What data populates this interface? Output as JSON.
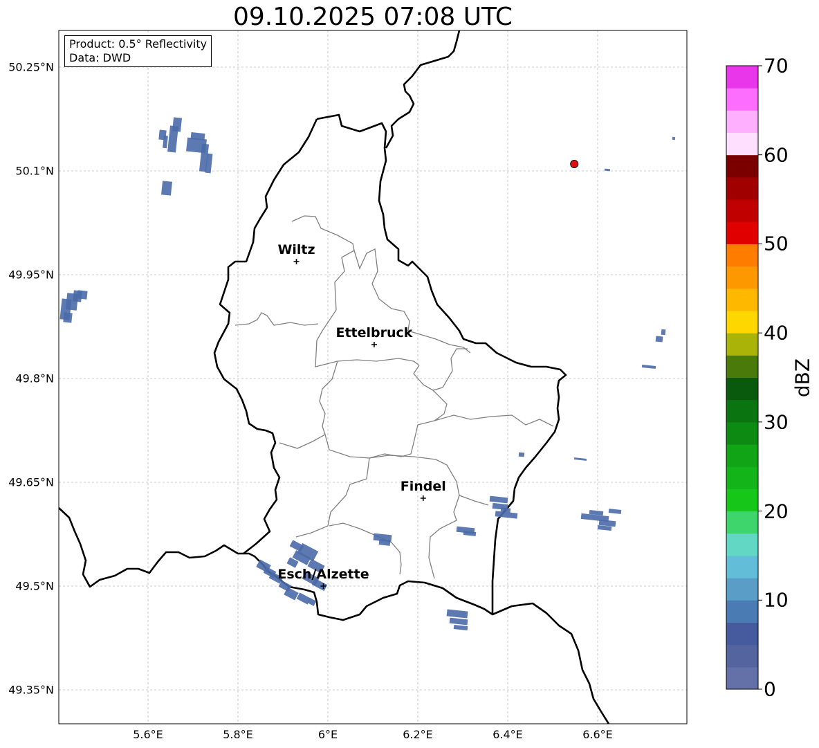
{
  "title": "09.10.2025 07:08 UTC",
  "info_box": {
    "product_line": "Product: 0.5° Reflectivity",
    "data_line": "Data: DWD"
  },
  "map": {
    "extent": {
      "lon_min": 5.4,
      "lon_max": 6.8,
      "lat_min": 49.3,
      "lat_max": 50.3
    },
    "lat_ticks": [
      {
        "value": 49.35,
        "label": "49.35°N"
      },
      {
        "value": 49.5,
        "label": "49.5°N"
      },
      {
        "value": 49.65,
        "label": "49.65°N"
      },
      {
        "value": 49.8,
        "label": "49.8°N"
      },
      {
        "value": 49.95,
        "label": "49.95°N"
      },
      {
        "value": 50.1,
        "label": "50.1°N"
      },
      {
        "value": 50.25,
        "label": "50.25°N"
      }
    ],
    "lon_ticks": [
      {
        "value": 5.6,
        "label": "5.6°E"
      },
      {
        "value": 5.8,
        "label": "5.8°E"
      },
      {
        "value": 6.0,
        "label": "6°E"
      },
      {
        "value": 6.2,
        "label": "6.2°E"
      },
      {
        "value": 6.4,
        "label": "6.4°E"
      },
      {
        "value": 6.6,
        "label": "6.6°E"
      }
    ],
    "cities": [
      {
        "name": "Wiltz",
        "lon": 5.93,
        "lat": 49.969
      },
      {
        "name": "Ettelbruck",
        "lon": 6.103,
        "lat": 49.849
      },
      {
        "name": "Findel",
        "lon": 6.212,
        "lat": 49.627
      },
      {
        "name": "Esch/Alzette",
        "lon": 5.99,
        "lat": 49.5
      }
    ],
    "radar_site": {
      "lon": 6.548,
      "lat": 50.11,
      "color": "#e01010"
    },
    "echo_color": "#4a6aa8"
  },
  "colorbar": {
    "label": "dBZ",
    "min": 0,
    "max": 70,
    "step": 2.5,
    "tick_values": [
      "0",
      "10",
      "20",
      "30",
      "40",
      "50",
      "60",
      "70"
    ],
    "colors": [
      "#6471a8",
      "#53649f",
      "#465a9e",
      "#4a7bb2",
      "#5a9ec8",
      "#62bed8",
      "#62d8c4",
      "#3ed66c",
      "#16c618",
      "#12b41a",
      "#10a416",
      "#0c8a12",
      "#0a7410",
      "#0a5a0e",
      "#4a7a0a",
      "#aab408",
      "#fed600",
      "#feb800",
      "#fe9800",
      "#fe7c00",
      "#e00000",
      "#c00000",
      "#a00000",
      "#7a0000",
      "#fee0fe",
      "#feb0fe",
      "#fe6efe",
      "#ea36ea"
    ]
  }
}
